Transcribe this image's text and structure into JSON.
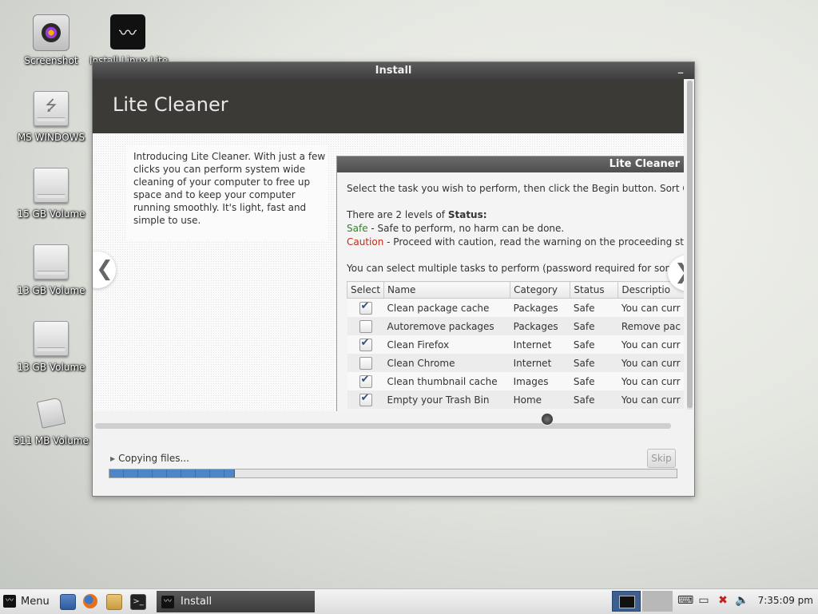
{
  "desktop": {
    "icons": [
      {
        "label": "Screenshot"
      },
      {
        "label": "Install Linux Lite"
      },
      {
        "label": "MS WINDOWS"
      },
      {
        "label": "15 GB Volume"
      },
      {
        "label": "13 GB Volume"
      },
      {
        "label": "13 GB Volume"
      },
      {
        "label": "511 MB Volume"
      }
    ]
  },
  "window": {
    "title": "Install",
    "minimize_glyph": "_"
  },
  "slide": {
    "banner_title": "Lite Cleaner",
    "intro_text": "Introducing Lite Cleaner. With just a few clicks you can perform system wide cleaning of your computer to free up space and to keep your computer running smoothly. It's light, fast and simple to use.",
    "prev_glyph": "❮",
    "next_glyph": "❯"
  },
  "cleaner": {
    "title": "Lite Cleaner",
    "instruction": "Select the task you wish to perform, then click the Begin button. Sort Cate",
    "levels_prefix": "There are 2 levels of ",
    "levels_bold": "Status:",
    "safe_word": "Safe",
    "safe_desc": " - Safe to perform, no harm can be done.",
    "caution_word": "Caution",
    "caution_desc": " - Proceed with caution, read the warning on the proceeding step",
    "multi_note": "You can select multiple tasks to perform (password required for some",
    "columns": [
      "Select",
      "Name",
      "Category",
      "Status",
      "Descriptio"
    ],
    "rows": [
      {
        "checked": true,
        "name": "Clean package cache",
        "category": "Packages",
        "status": "Safe",
        "description": "You can curr"
      },
      {
        "checked": false,
        "name": "Autoremove packages",
        "category": "Packages",
        "status": "Safe",
        "description": "Remove pac"
      },
      {
        "checked": true,
        "name": "Clean Firefox",
        "category": "Internet",
        "status": "Safe",
        "description": "You can curr"
      },
      {
        "checked": false,
        "name": "Clean Chrome",
        "category": "Internet",
        "status": "Safe",
        "description": "You can curr"
      },
      {
        "checked": true,
        "name": "Clean thumbnail cache",
        "category": "Images",
        "status": "Safe",
        "description": "You can curr"
      },
      {
        "checked": true,
        "name": "Empty your Trash Bin",
        "category": "Home",
        "status": "Safe",
        "description": "You can curr"
      }
    ],
    "colors": {
      "safe": "#2a8a1e",
      "caution": "#c02a1a"
    }
  },
  "installer": {
    "status_text": "Copying files...",
    "skip_label": "Skip",
    "progress_fraction": 0.22
  },
  "taskbar": {
    "menu_label": "Menu",
    "launchers": [
      "file-manager-icon",
      "firefox-icon",
      "home-folder-icon",
      "terminal-icon"
    ],
    "active_task": "Install",
    "tray_icons": [
      "keyboard-icon",
      "battery-icon",
      "network-disconnected-icon",
      "volume-icon"
    ],
    "clock": "7:35:09 pm"
  }
}
